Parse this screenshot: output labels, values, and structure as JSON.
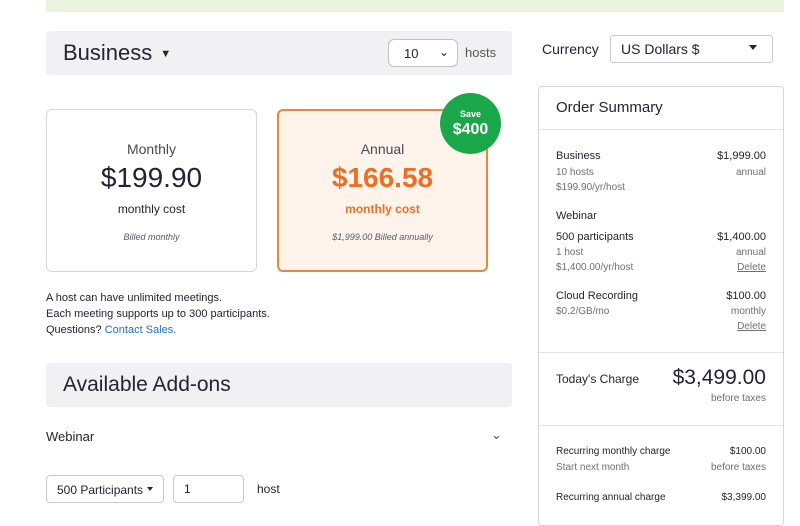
{
  "plan": {
    "title": "Business",
    "hosts_value": "10",
    "hosts_label": "hosts"
  },
  "currency": {
    "label": "Currency",
    "value": "US Dollars $"
  },
  "pricing": {
    "monthly": {
      "title": "Monthly",
      "price": "$199.90",
      "sub": "monthly cost",
      "billed": "Billed monthly"
    },
    "annual": {
      "title": "Annual",
      "price": "$166.58",
      "sub": "monthly cost",
      "billed": "$1,999.00 Billed annually"
    },
    "save_badge": {
      "line1": "Save",
      "line2": "$400"
    }
  },
  "info": {
    "line1": "A host can have unlimited meetings.",
    "line2": "Each meeting supports up to 300 participants.",
    "questions": "Questions?",
    "contact_link": "Contact Sales."
  },
  "addons": {
    "title": "Available Add-ons",
    "webinar_label": "Webinar",
    "participants_value": "500 Participants",
    "host_count": "1",
    "host_label": "host"
  },
  "summary": {
    "title": "Order Summary",
    "business": {
      "name": "Business",
      "amount": "$1,999.00",
      "hosts": "10 hosts",
      "period": "annual",
      "rate": "$199.90/yr/host"
    },
    "webinar": {
      "name": "Webinar",
      "participants": "500 participants",
      "amount": "$1,400.00",
      "hosts": "1 host",
      "period": "annual",
      "rate": "$1,400.00/yr/host",
      "delete": "Delete"
    },
    "cloud": {
      "name": "Cloud Recording",
      "amount": "$100.00",
      "rate": "$0.2/GB/mo",
      "period": "monthly",
      "delete": "Delete"
    },
    "today": {
      "label": "Today's Charge",
      "amount": "$3,499.00",
      "note": "before taxes"
    },
    "recurring_monthly": {
      "label": "Recurring monthly charge",
      "amount": "$100.00",
      "start": "Start next month",
      "note": "before taxes"
    },
    "recurring_annual": {
      "label": "Recurring annual charge",
      "amount": "$3,399.00"
    }
  },
  "colors": {
    "accent_orange": "#ec6f27",
    "save_green": "#1aa74a",
    "link_blue": "#1b6ed6"
  }
}
